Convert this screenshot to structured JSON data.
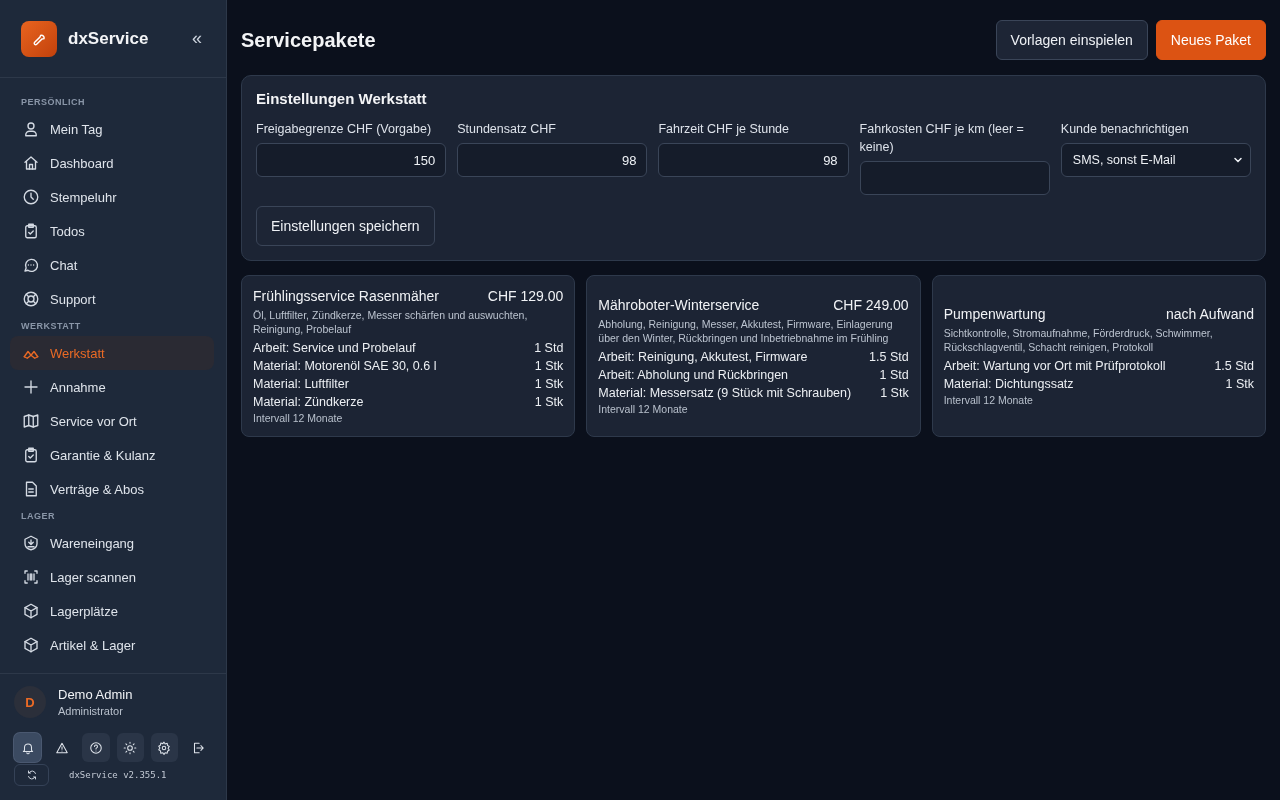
{
  "app": {
    "name": "dxService",
    "collapse_icon": "«"
  },
  "sidebar": {
    "sections": [
      {
        "title": "PERSÖNLICH",
        "items": [
          {
            "label": "Mein Tag",
            "selected": false
          },
          {
            "label": "Dashboard",
            "selected": false
          },
          {
            "label": "Stempeluhr",
            "selected": false
          },
          {
            "label": "Todos",
            "selected": false
          },
          {
            "label": "Chat",
            "selected": false
          },
          {
            "label": "Support",
            "selected": false
          }
        ]
      },
      {
        "title": "WERKSTATT",
        "items": [
          {
            "label": "Werkstatt",
            "selected": true
          },
          {
            "label": "Annahme",
            "selected": false
          },
          {
            "label": "Service vor Ort",
            "selected": false
          },
          {
            "label": "Garantie & Kulanz",
            "selected": false
          },
          {
            "label": "Verträge & Abos",
            "selected": false
          }
        ]
      },
      {
        "title": "LAGER",
        "items": [
          {
            "label": "Wareneingang",
            "selected": false
          },
          {
            "label": "Lager scannen",
            "selected": false
          },
          {
            "label": "Lagerplätze",
            "selected": false
          },
          {
            "label": "Artikel & Lager",
            "selected": false
          }
        ]
      }
    ]
  },
  "user": {
    "initial": "D",
    "name": "Demo Admin",
    "role": "Administrator"
  },
  "toolbar": [
    {
      "framed": true,
      "selected": true
    },
    {
      "framed": false,
      "selected": false
    },
    {
      "framed": true,
      "selected": false
    },
    {
      "framed": true,
      "selected": false
    },
    {
      "framed": true,
      "selected": false
    },
    {
      "framed": false,
      "selected": false
    }
  ],
  "version": "dxService v2.355.1",
  "page": {
    "title": "Servicepakete",
    "buttons": [
      {
        "label": "Vorlagen einspielen",
        "kind": "secondary"
      },
      {
        "label": "Neues Paket",
        "kind": "primary"
      }
    ]
  },
  "settings": {
    "title": "Einstellungen Werkstatt",
    "fields": [
      {
        "label": "Freigabegrenze CHF (Vorgabe)",
        "kind": "number",
        "value": "150"
      },
      {
        "label": "Stundensatz CHF",
        "kind": "number",
        "value": "98"
      },
      {
        "label": "Fahrzeit CHF je Stunde",
        "kind": "number",
        "value": "98"
      },
      {
        "label": "Fahrkosten CHF je km (leer = keine)",
        "kind": "number"
      },
      {
        "label": "Kunde benachrichtigen",
        "kind": "select",
        "value": "SMS, sonst E-Mail"
      }
    ],
    "save_button": "Einstellungen speichern"
  },
  "packages": [
    {
      "title": "Frühlingsservice Rasenmäher",
      "price": "CHF 129.00",
      "description": "Öl, Luftfilter, Zündkerze, Messer schärfen und auswuchten, Reinigung, Probelauf",
      "lines": [
        {
          "text": "Arbeit: Service und Probelauf",
          "qty": "1 Std"
        },
        {
          "text": "Material: Motorenöl SAE 30, 0.6 l",
          "qty": "1 Stk"
        },
        {
          "text": "Material: Luftfilter",
          "qty": "1 Stk"
        },
        {
          "text": "Material: Zündkerze",
          "qty": "1 Stk"
        }
      ],
      "interval": "Intervall 12 Monate"
    },
    {
      "title": "Mähroboter-Winterservice",
      "price": "CHF 249.00",
      "description": "Abholung, Reinigung, Messer, Akkutest, Firmware, Einlagerung über den Winter, Rückbringen und Inbetriebnahme im Frühling",
      "lines": [
        {
          "text": "Arbeit: Reinigung, Akkutest, Firmware",
          "qty": "1.5 Std"
        },
        {
          "text": "Arbeit: Abholung und Rückbringen",
          "qty": "1 Std"
        },
        {
          "text": "Material: Messersatz (9 Stück mit Schrauben)",
          "qty": "1 Stk"
        }
      ],
      "interval": "Intervall 12 Monate"
    },
    {
      "title": "Pumpenwartung",
      "price": "nach Aufwand",
      "description": "Sichtkontrolle, Stromaufnahme, Förderdruck, Schwimmer, Rückschlagventil, Schacht reinigen, Protokoll",
      "lines": [
        {
          "text": "Arbeit: Wartung vor Ort mit Prüfprotokoll",
          "qty": "1.5 Std"
        },
        {
          "text": "Material: Dichtungssatz",
          "qty": "1 Stk"
        }
      ],
      "interval": "Intervall 12 Monate"
    }
  ]
}
